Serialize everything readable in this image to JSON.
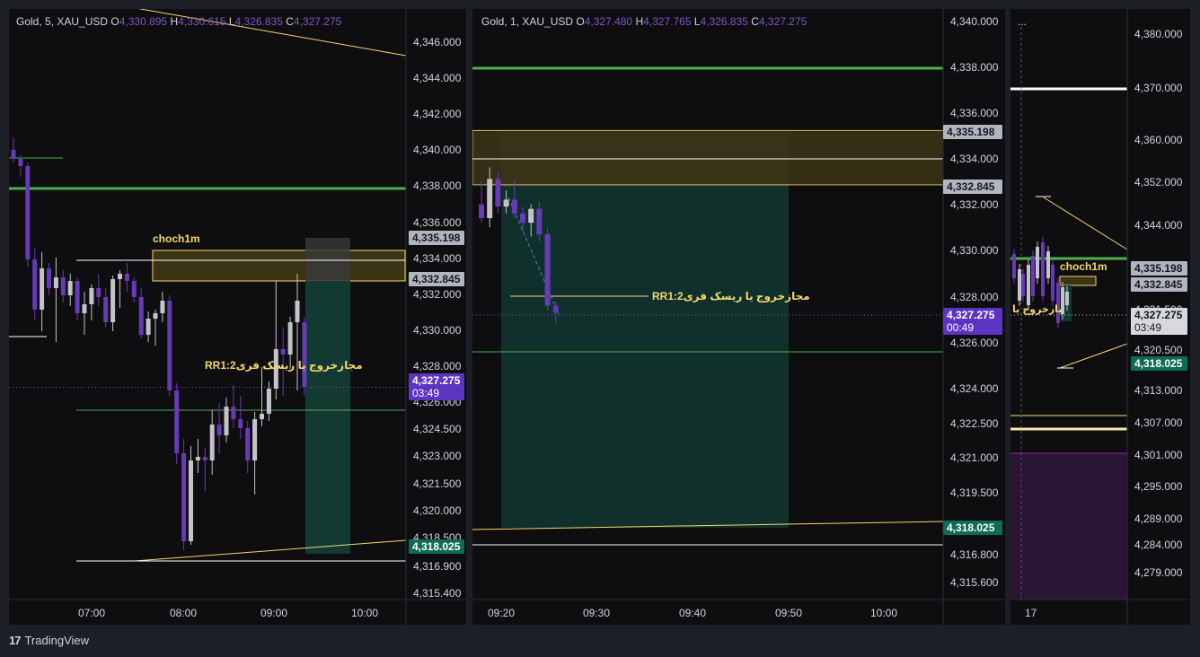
{
  "brand": {
    "name": "TradingView",
    "logo": "17"
  },
  "colors": {
    "bg": "#0e0e10",
    "bull": "#c3c3c9",
    "bear": "#673ab7",
    "green": "#4caf50",
    "yellow": "#f5d76e",
    "zone": "#3a3415",
    "target": "#123a33",
    "stop": "#3a3a3a",
    "price_tag": "#5b34c2",
    "target_tag": "#0e6b55",
    "tag_grey": "#b2b5be",
    "purple_zone": "#2a1535"
  },
  "chart_data": [
    {
      "type": "candlestick",
      "title": "Gold, 5, XAU_USD",
      "ohlc_header": {
        "o_label": "O",
        "o": "4,330.895",
        "h_label": "H",
        "h": "4,330.615",
        "l_label": "L",
        "l": "4,326.835",
        "c_label": "C",
        "c": "4,327.275"
      },
      "y_ticks": [
        "4,346.000",
        "4,344.000",
        "4,342.000",
        "4,340.000",
        "4,338.000",
        "4,336.000",
        "4,334.000",
        "4,332.000",
        "4,330.000",
        "4,328.000",
        "4,326.000",
        "4,324.500",
        "4,323.000",
        "4,321.500",
        "4,320.000",
        "4,318.500",
        "4,316.900",
        "4,315.400"
      ],
      "x_ticks": [
        "07:00",
        "08:00",
        "09:00",
        "10:00"
      ],
      "price_labels": [
        {
          "text": "4,335.198",
          "kind": "grey"
        },
        {
          "text": "4,332.845",
          "kind": "grey"
        },
        {
          "text": "4,327.275",
          "sub": "03:49",
          "kind": "price"
        },
        {
          "text": "4,318.025",
          "kind": "target"
        }
      ],
      "annotations": [
        "choch1m",
        "RR1:2مجازخروج یا ریسک فری"
      ],
      "candles": [
        [
          4340.5,
          4341.2,
          4339.8,
          4340.0
        ],
        [
          4340.0,
          4340.2,
          4339.0,
          4339.6
        ],
        [
          4339.6,
          4339.8,
          4334.0,
          4334.4
        ],
        [
          4334.4,
          4335.0,
          4331.0,
          4331.6
        ],
        [
          4331.6,
          4334.8,
          4330.4,
          4333.9
        ],
        [
          4333.9,
          4334.2,
          4332.4,
          4332.8
        ],
        [
          4332.8,
          4334.5,
          4329.8,
          4333.4
        ],
        [
          4333.4,
          4333.8,
          4332.0,
          4332.4
        ],
        [
          4332.4,
          4333.6,
          4331.8,
          4333.2
        ],
        [
          4333.2,
          4333.4,
          4331.0,
          4331.4
        ],
        [
          4331.4,
          4332.6,
          4330.2,
          4331.9
        ],
        [
          4331.9,
          4333.0,
          4331.0,
          4332.8
        ],
        [
          4332.8,
          4333.6,
          4331.8,
          4332.3
        ],
        [
          4332.3,
          4332.8,
          4330.6,
          4330.9
        ],
        [
          4330.9,
          4333.5,
          4330.4,
          4333.3
        ],
        [
          4333.3,
          4333.8,
          4331.7,
          4333.6
        ],
        [
          4333.6,
          4334.2,
          4332.6,
          4333.2
        ],
        [
          4333.2,
          4333.4,
          4332.0,
          4332.3
        ],
        [
          4332.3,
          4332.8,
          4330.0,
          4330.2
        ],
        [
          4330.2,
          4331.5,
          4329.8,
          4331.1
        ],
        [
          4331.1,
          4331.6,
          4329.6,
          4331.4
        ],
        [
          4331.4,
          4332.6,
          4330.9,
          4332.1
        ],
        [
          4332.1,
          4332.4,
          4326.8,
          4327.1
        ],
        [
          4327.1,
          4327.5,
          4323.0,
          4323.6
        ],
        [
          4323.6,
          4324.4,
          4318.2,
          4318.7
        ],
        [
          4318.7,
          4324.0,
          4318.5,
          4323.2
        ],
        [
          4323.2,
          4324.4,
          4322.5,
          4323.4
        ],
        [
          4323.4,
          4323.9,
          4321.5,
          4323.2
        ],
        [
          4323.2,
          4326.0,
          4322.4,
          4325.2
        ],
        [
          4325.2,
          4326.4,
          4323.6,
          4324.6
        ],
        [
          4324.6,
          4326.7,
          4324.2,
          4326.2
        ],
        [
          4326.2,
          4327.4,
          4325.0,
          4325.5
        ],
        [
          4325.5,
          4326.8,
          4324.4,
          4325.0
        ],
        [
          4325.0,
          4325.4,
          4322.5,
          4323.2
        ],
        [
          4323.2,
          4325.9,
          4321.3,
          4325.5
        ],
        [
          4325.5,
          4328.4,
          4325.1,
          4325.8
        ],
        [
          4325.8,
          4327.6,
          4325.4,
          4327.2
        ],
        [
          4327.2,
          4333.2,
          4326.6,
          4329.4
        ],
        [
          4329.4,
          4330.6,
          4326.8,
          4329.1
        ],
        [
          4329.1,
          4331.2,
          4328.3,
          4330.9
        ],
        [
          4330.9,
          4333.6,
          4327.1,
          4332.1
        ],
        [
          4330.9,
          4331.2,
          4326.8,
          4327.3
        ]
      ]
    },
    {
      "type": "candlestick",
      "title": "Gold, 1, XAU_USD",
      "ohlc_header": {
        "o_label": "O",
        "o": "4,327.480",
        "h_label": "H",
        "h": "4,327.765",
        "l_label": "L",
        "l": "4,326.835",
        "c_label": "C",
        "c": "4,327.275"
      },
      "y_ticks": [
        "4,340.000",
        "4,338.000",
        "4,336.000",
        "4,334.000",
        "4,332.000",
        "4,330.000",
        "4,328.000",
        "4,326.000",
        "4,324.000",
        "4,322.500",
        "4,321.000",
        "4,319.500",
        "4,316.800",
        "4,315.600"
      ],
      "x_ticks": [
        "09:20",
        "09:30",
        "09:40",
        "09:50",
        "10:00"
      ],
      "price_labels": [
        {
          "text": "4,335.198",
          "kind": "grey"
        },
        {
          "text": "4,332.845",
          "kind": "grey"
        },
        {
          "text": "4,327.275",
          "sub": "00:49",
          "kind": "price"
        },
        {
          "text": "4,318.025",
          "kind": "target"
        }
      ],
      "annotations": [
        "RR1:2مجازخروج یا ریسک فری"
      ],
      "candles": [
        [
          4332.0,
          4333.0,
          4331.2,
          4331.4
        ],
        [
          4331.4,
          4333.6,
          4331.0,
          4333.1
        ],
        [
          4333.1,
          4333.4,
          4331.6,
          4331.9
        ],
        [
          4331.9,
          4332.6,
          4331.6,
          4332.2
        ],
        [
          4332.2,
          4333.1,
          4331.4,
          4331.6
        ],
        [
          4331.6,
          4331.9,
          4330.8,
          4331.2
        ],
        [
          4331.2,
          4332.0,
          4330.6,
          4331.8
        ],
        [
          4331.8,
          4332.1,
          4330.4,
          4330.7
        ],
        [
          4330.7,
          4331.0,
          4327.4,
          4327.6
        ],
        [
          4327.6,
          4327.8,
          4326.8,
          4327.3
        ]
      ]
    },
    {
      "type": "candlestick",
      "title": "",
      "ohlc_header": {
        "o_label": "",
        "o": "",
        "h_label": "",
        "h": "",
        "l_label": "",
        "l": "",
        "c_label": "",
        "c": ""
      },
      "menu": "...",
      "y_ticks": [
        "4,380.000",
        "4,370.000",
        "4,360.000",
        "4,352.000",
        "4,344.000",
        "4,337.500",
        "4,331.500",
        "4,326.000",
        "4,320.500",
        "4,313.000",
        "4,307.000",
        "4,301.000",
        "4,295.000",
        "4,289.000",
        "4,284.000",
        "4,279.000"
      ],
      "x_ticks": [
        "17"
      ],
      "price_labels": [
        {
          "text": "4,335.198",
          "kind": "grey"
        },
        {
          "text": "4,332.845",
          "kind": "grey"
        },
        {
          "text": "4,327.275",
          "sub": "03:49",
          "kind": "light"
        },
        {
          "text": "4,318.025",
          "kind": "target"
        }
      ],
      "annotations": [
        "choch1m",
        "بازخروج یا"
      ],
      "candles": []
    }
  ]
}
